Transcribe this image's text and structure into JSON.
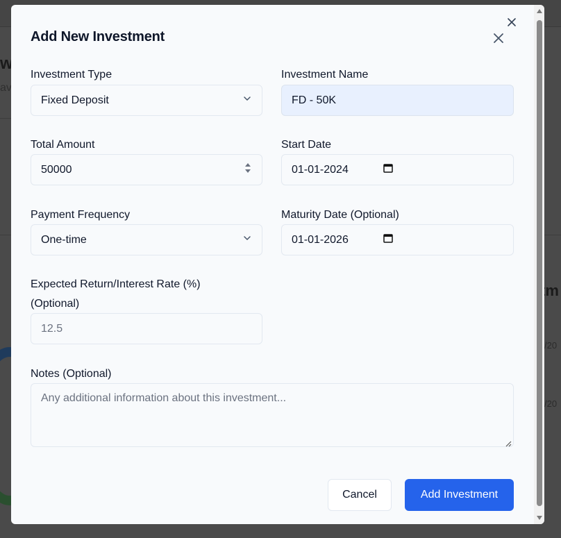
{
  "background": {
    "heading": "w",
    "subtext": "av",
    "right_heading": "tm",
    "right_small_1": "/20",
    "right_small_2": "/20"
  },
  "modal": {
    "title": "Add New Investment",
    "fields": {
      "investment_type": {
        "label": "Investment Type",
        "value": "Fixed Deposit"
      },
      "investment_name": {
        "label": "Investment Name",
        "value": "FD - 50K"
      },
      "total_amount": {
        "label": "Total Amount",
        "value": "50000"
      },
      "start_date": {
        "label": "Start Date",
        "value": "01-01-2024"
      },
      "payment_frequency": {
        "label": "Payment Frequency",
        "value": "One-time"
      },
      "maturity_date": {
        "label": "Maturity Date (Optional)",
        "value": "01-01-2026"
      },
      "expected_return": {
        "label_line1": "Expected Return/Interest Rate (%)",
        "label_line2": "(Optional)",
        "placeholder": "12.5"
      },
      "notes": {
        "label": "Notes (Optional)",
        "placeholder": "Any additional information about this investment..."
      }
    },
    "buttons": {
      "cancel": "Cancel",
      "submit": "Add Investment"
    }
  },
  "colors": {
    "primary": "#2563eb",
    "highlight_field": "#e8f0fe",
    "overlay": "#4a4a4a"
  },
  "icons": [
    "close-icon",
    "chevron-down-icon",
    "spinner-icon",
    "calendar-icon",
    "resize-handle-icon"
  ]
}
